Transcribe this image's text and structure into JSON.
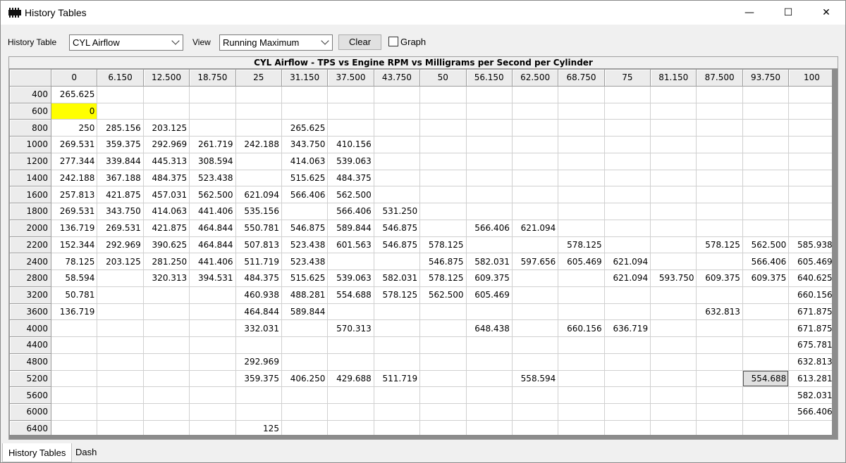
{
  "window": {
    "title": "History Tables",
    "controls": {
      "minimize": "—",
      "maximize": "☐",
      "close": "✕"
    }
  },
  "toolbar": {
    "history_table_label": "History Table",
    "history_table_value": "CYL Airflow",
    "view_label": "View",
    "view_value": "Running Maximum",
    "clear_label": "Clear",
    "graph_label": "Graph",
    "graph_checked": false
  },
  "table": {
    "title": "CYL Airflow - TPS vs Engine RPM vs Milligrams per Second per Cylinder",
    "columns": [
      "0",
      "6.150",
      "12.500",
      "18.750",
      "25",
      "31.150",
      "37.500",
      "43.750",
      "50",
      "56.150",
      "62.500",
      "68.750",
      "75",
      "81.150",
      "87.500",
      "93.750",
      "100"
    ],
    "rows": [
      {
        "rpm": "400",
        "cells": [
          "265.625",
          "",
          "",
          "",
          "",
          "",
          "",
          "",
          "",
          "",
          "",
          "",
          "",
          "",
          "",
          "",
          ""
        ]
      },
      {
        "rpm": "600",
        "cells": [
          "0",
          "",
          "",
          "",
          "",
          "",
          "",
          "",
          "",
          "",
          "",
          "",
          "",
          "",
          "",
          "",
          ""
        ]
      },
      {
        "rpm": "800",
        "cells": [
          "250",
          "285.156",
          "203.125",
          "",
          "",
          "265.625",
          "",
          "",
          "",
          "",
          "",
          "",
          "",
          "",
          "",
          "",
          ""
        ]
      },
      {
        "rpm": "1000",
        "cells": [
          "269.531",
          "359.375",
          "292.969",
          "261.719",
          "242.188",
          "343.750",
          "410.156",
          "",
          "",
          "",
          "",
          "",
          "",
          "",
          "",
          "",
          ""
        ]
      },
      {
        "rpm": "1200",
        "cells": [
          "277.344",
          "339.844",
          "445.313",
          "308.594",
          "",
          "414.063",
          "539.063",
          "",
          "",
          "",
          "",
          "",
          "",
          "",
          "",
          "",
          ""
        ]
      },
      {
        "rpm": "1400",
        "cells": [
          "242.188",
          "367.188",
          "484.375",
          "523.438",
          "",
          "515.625",
          "484.375",
          "",
          "",
          "",
          "",
          "",
          "",
          "",
          "",
          "",
          ""
        ]
      },
      {
        "rpm": "1600",
        "cells": [
          "257.813",
          "421.875",
          "457.031",
          "562.500",
          "621.094",
          "566.406",
          "562.500",
          "",
          "",
          "",
          "",
          "",
          "",
          "",
          "",
          "",
          ""
        ]
      },
      {
        "rpm": "1800",
        "cells": [
          "269.531",
          "343.750",
          "414.063",
          "441.406",
          "535.156",
          "",
          "566.406",
          "531.250",
          "",
          "",
          "",
          "",
          "",
          "",
          "",
          "",
          ""
        ]
      },
      {
        "rpm": "2000",
        "cells": [
          "136.719",
          "269.531",
          "421.875",
          "464.844",
          "550.781",
          "546.875",
          "589.844",
          "546.875",
          "",
          "566.406",
          "621.094",
          "",
          "",
          "",
          "",
          "",
          ""
        ]
      },
      {
        "rpm": "2200",
        "cells": [
          "152.344",
          "292.969",
          "390.625",
          "464.844",
          "507.813",
          "523.438",
          "601.563",
          "546.875",
          "578.125",
          "",
          "",
          "578.125",
          "",
          "",
          "578.125",
          "562.500",
          "585.938"
        ]
      },
      {
        "rpm": "2400",
        "cells": [
          "78.125",
          "203.125",
          "281.250",
          "441.406",
          "511.719",
          "523.438",
          "",
          "",
          "546.875",
          "582.031",
          "597.656",
          "605.469",
          "621.094",
          "",
          "",
          "566.406",
          "605.469"
        ]
      },
      {
        "rpm": "2800",
        "cells": [
          "58.594",
          "",
          "320.313",
          "394.531",
          "484.375",
          "515.625",
          "539.063",
          "582.031",
          "578.125",
          "609.375",
          "",
          "",
          "621.094",
          "593.750",
          "609.375",
          "609.375",
          "640.625"
        ]
      },
      {
        "rpm": "3200",
        "cells": [
          "50.781",
          "",
          "",
          "",
          "460.938",
          "488.281",
          "554.688",
          "578.125",
          "562.500",
          "605.469",
          "",
          "",
          "",
          "",
          "",
          "",
          "660.156"
        ]
      },
      {
        "rpm": "3600",
        "cells": [
          "136.719",
          "",
          "",
          "",
          "464.844",
          "589.844",
          "",
          "",
          "",
          "",
          "",
          "",
          "",
          "",
          "632.813",
          "",
          "671.875"
        ]
      },
      {
        "rpm": "4000",
        "cells": [
          "",
          "",
          "",
          "",
          "332.031",
          "",
          "570.313",
          "",
          "",
          "648.438",
          "",
          "660.156",
          "636.719",
          "",
          "",
          "",
          "671.875"
        ]
      },
      {
        "rpm": "4400",
        "cells": [
          "",
          "",
          "",
          "",
          "",
          "",
          "",
          "",
          "",
          "",
          "",
          "",
          "",
          "",
          "",
          "",
          "675.781"
        ]
      },
      {
        "rpm": "4800",
        "cells": [
          "",
          "",
          "",
          "",
          "292.969",
          "",
          "",
          "",
          "",
          "",
          "",
          "",
          "",
          "",
          "",
          "",
          "632.813"
        ]
      },
      {
        "rpm": "5200",
        "cells": [
          "",
          "",
          "",
          "",
          "359.375",
          "406.250",
          "429.688",
          "511.719",
          "",
          "",
          "558.594",
          "",
          "",
          "",
          "",
          "554.688",
          "613.281"
        ]
      },
      {
        "rpm": "5600",
        "cells": [
          "",
          "",
          "",
          "",
          "",
          "",
          "",
          "",
          "",
          "",
          "",
          "",
          "",
          "",
          "",
          "",
          "582.031"
        ]
      },
      {
        "rpm": "6000",
        "cells": [
          "",
          "",
          "",
          "",
          "",
          "",
          "",
          "",
          "",
          "",
          "",
          "",
          "",
          "",
          "",
          "",
          "566.406"
        ]
      },
      {
        "rpm": "6400",
        "cells": [
          "",
          "",
          "",
          "",
          "125",
          "",
          "",
          "",
          "",
          "",
          "",
          "",
          "",
          "",
          "",
          "",
          ""
        ]
      }
    ],
    "highlight_color": "#ffff00",
    "highlighted_cell": {
      "row": 1,
      "col": 0
    },
    "selected_cell": {
      "row": 17,
      "col": 15
    }
  },
  "tabs": [
    {
      "label": "History Tables",
      "active": true
    },
    {
      "label": "Dash",
      "active": false
    }
  ]
}
